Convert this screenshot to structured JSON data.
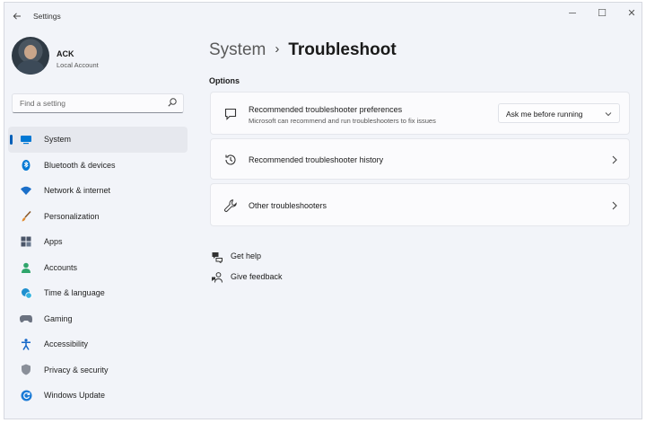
{
  "window": {
    "title": "Settings",
    "controls": {
      "minimize": "─",
      "maximize": "☐",
      "close": "✕"
    }
  },
  "user": {
    "name": "ACK",
    "account_type": "Local Account"
  },
  "search": {
    "placeholder": "Find a setting",
    "value": ""
  },
  "sidebar": {
    "items": [
      {
        "label": "System",
        "icon": "monitor-icon",
        "active": true,
        "color": "#0078d4"
      },
      {
        "label": "Bluetooth & devices",
        "icon": "bluetooth-icon",
        "color": "#0078d4"
      },
      {
        "label": "Network & internet",
        "icon": "wifi-icon",
        "color": "#1b6fc9"
      },
      {
        "label": "Personalization",
        "icon": "brush-icon",
        "color": "#d87b2a"
      },
      {
        "label": "Apps",
        "icon": "apps-icon",
        "color": "#4a5568"
      },
      {
        "label": "Accounts",
        "icon": "person-icon",
        "color": "#2fa56b"
      },
      {
        "label": "Time & language",
        "icon": "globe-clock-icon",
        "color": "#1f8fcf"
      },
      {
        "label": "Gaming",
        "icon": "gamepad-icon",
        "color": "#6b7280"
      },
      {
        "label": "Accessibility",
        "icon": "accessibility-icon",
        "color": "#1668c8"
      },
      {
        "label": "Privacy & security",
        "icon": "shield-icon",
        "color": "#8a8f99"
      },
      {
        "label": "Windows Update",
        "icon": "update-icon",
        "color": "#1a7ad6"
      }
    ]
  },
  "main": {
    "breadcrumb": {
      "parent": "System",
      "separator": "›",
      "current": "Troubleshoot"
    },
    "section_title": "Options",
    "cards": [
      {
        "icon": "chat-icon",
        "title": "Recommended troubleshooter preferences",
        "description": "Microsoft can recommend and run troubleshooters to fix issues",
        "dropdown_value": "Ask me before running"
      },
      {
        "icon": "history-icon",
        "title": "Recommended troubleshooter history"
      },
      {
        "icon": "wrench-icon",
        "title": "Other troubleshooters"
      }
    ],
    "links": [
      {
        "icon": "help-icon",
        "label": "Get help"
      },
      {
        "icon": "feedback-icon",
        "label": "Give feedback"
      }
    ]
  },
  "colors": {
    "accent": "#005fb8",
    "background": "#f2f4f9",
    "card": "#fbfbfd"
  }
}
